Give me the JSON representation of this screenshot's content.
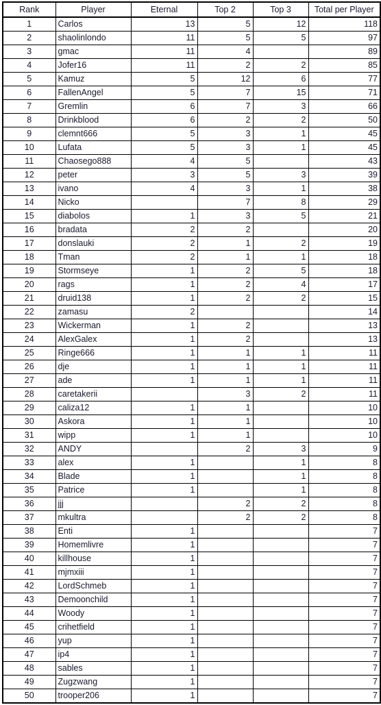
{
  "table": {
    "columns": [
      {
        "key": "rank",
        "label": "Rank",
        "align": "center"
      },
      {
        "key": "player",
        "label": "Player",
        "align": "left"
      },
      {
        "key": "eternal",
        "label": "Eternal",
        "align": "right"
      },
      {
        "key": "top2",
        "label": "Top 2",
        "align": "right"
      },
      {
        "key": "top3",
        "label": "Top 3",
        "align": "right"
      },
      {
        "key": "total",
        "label": "Total per Player",
        "align": "right"
      }
    ],
    "row_count": 50,
    "colors": {
      "text": "#1a1a2e",
      "grid": "#000000",
      "background": "#ffffff"
    },
    "rows": [
      {
        "rank": "1",
        "player": "Carlos",
        "eternal": "13",
        "top2": "5",
        "top3": "12",
        "total": "118"
      },
      {
        "rank": "2",
        "player": "shaolinlondo",
        "eternal": "11",
        "top2": "5",
        "top3": "5",
        "total": "97"
      },
      {
        "rank": "3",
        "player": "gmac",
        "eternal": "11",
        "top2": "4",
        "top3": "",
        "total": "89"
      },
      {
        "rank": "4",
        "player": "Jofer16",
        "eternal": "11",
        "top2": "2",
        "top3": "2",
        "total": "85"
      },
      {
        "rank": "5",
        "player": "Kamuz",
        "eternal": "5",
        "top2": "12",
        "top3": "6",
        "total": "77"
      },
      {
        "rank": "6",
        "player": "FallenAngel",
        "eternal": "5",
        "top2": "7",
        "top3": "15",
        "total": "71"
      },
      {
        "rank": "7",
        "player": "Gremlin",
        "eternal": "6",
        "top2": "7",
        "top3": "3",
        "total": "66"
      },
      {
        "rank": "8",
        "player": "Drinkblood",
        "eternal": "6",
        "top2": "2",
        "top3": "2",
        "total": "50"
      },
      {
        "rank": "9",
        "player": "clemnt666",
        "eternal": "5",
        "top2": "3",
        "top3": "1",
        "total": "45"
      },
      {
        "rank": "10",
        "player": "Lufata",
        "eternal": "5",
        "top2": "3",
        "top3": "1",
        "total": "45"
      },
      {
        "rank": "11",
        "player": "Chaosego888",
        "eternal": "4",
        "top2": "5",
        "top3": "",
        "total": "43"
      },
      {
        "rank": "12",
        "player": "peter",
        "eternal": "3",
        "top2": "5",
        "top3": "3",
        "total": "39"
      },
      {
        "rank": "13",
        "player": "ivano",
        "eternal": "4",
        "top2": "3",
        "top3": "1",
        "total": "38"
      },
      {
        "rank": "14",
        "player": "Nicko",
        "eternal": "",
        "top2": "7",
        "top3": "8",
        "total": "29"
      },
      {
        "rank": "15",
        "player": "diabolos",
        "eternal": "1",
        "top2": "3",
        "top3": "5",
        "total": "21"
      },
      {
        "rank": "16",
        "player": "bradata",
        "eternal": "2",
        "top2": "2",
        "top3": "",
        "total": "20"
      },
      {
        "rank": "17",
        "player": "donslauki",
        "eternal": "2",
        "top2": "1",
        "top3": "2",
        "total": "19"
      },
      {
        "rank": "18",
        "player": "Tman",
        "eternal": "2",
        "top2": "1",
        "top3": "1",
        "total": "18"
      },
      {
        "rank": "19",
        "player": "Stormseye",
        "eternal": "1",
        "top2": "2",
        "top3": "5",
        "total": "18"
      },
      {
        "rank": "20",
        "player": "rags",
        "eternal": "1",
        "top2": "2",
        "top3": "4",
        "total": "17"
      },
      {
        "rank": "21",
        "player": "druid138",
        "eternal": "1",
        "top2": "2",
        "top3": "2",
        "total": "15"
      },
      {
        "rank": "22",
        "player": "zamasu",
        "eternal": "2",
        "top2": "",
        "top3": "",
        "total": "14"
      },
      {
        "rank": "23",
        "player": "Wickerman",
        "eternal": "1",
        "top2": "2",
        "top3": "",
        "total": "13"
      },
      {
        "rank": "24",
        "player": "AlexGalex",
        "eternal": "1",
        "top2": "2",
        "top3": "",
        "total": "13"
      },
      {
        "rank": "25",
        "player": "Ringe666",
        "eternal": "1",
        "top2": "1",
        "top3": "1",
        "total": "11"
      },
      {
        "rank": "26",
        "player": "dje",
        "eternal": "1",
        "top2": "1",
        "top3": "1",
        "total": "11"
      },
      {
        "rank": "27",
        "player": "ade",
        "eternal": "1",
        "top2": "1",
        "top3": "1",
        "total": "11"
      },
      {
        "rank": "28",
        "player": "caretakerii",
        "eternal": "",
        "top2": "3",
        "top3": "2",
        "total": "11"
      },
      {
        "rank": "29",
        "player": "caliza12",
        "eternal": "1",
        "top2": "1",
        "top3": "",
        "total": "10"
      },
      {
        "rank": "30",
        "player": "Askora",
        "eternal": "1",
        "top2": "1",
        "top3": "",
        "total": "10"
      },
      {
        "rank": "31",
        "player": "wipp",
        "eternal": "1",
        "top2": "1",
        "top3": "",
        "total": "10"
      },
      {
        "rank": "32",
        "player": "ANDY",
        "eternal": "",
        "top2": "2",
        "top3": "3",
        "total": "9"
      },
      {
        "rank": "33",
        "player": "alex",
        "eternal": "1",
        "top2": "",
        "top3": "1",
        "total": "8"
      },
      {
        "rank": "34",
        "player": "Blade",
        "eternal": "1",
        "top2": "",
        "top3": "1",
        "total": "8"
      },
      {
        "rank": "35",
        "player": "Patrice",
        "eternal": "1",
        "top2": "",
        "top3": "1",
        "total": "8"
      },
      {
        "rank": "36",
        "player": "jjj",
        "eternal": "",
        "top2": "2",
        "top3": "2",
        "total": "8"
      },
      {
        "rank": "37",
        "player": "mkultra",
        "eternal": "",
        "top2": "2",
        "top3": "2",
        "total": "8"
      },
      {
        "rank": "38",
        "player": "Enti",
        "eternal": "1",
        "top2": "",
        "top3": "",
        "total": "7"
      },
      {
        "rank": "39",
        "player": "Homemlivre",
        "eternal": "1",
        "top2": "",
        "top3": "",
        "total": "7"
      },
      {
        "rank": "40",
        "player": "killhouse",
        "eternal": "1",
        "top2": "",
        "top3": "",
        "total": "7"
      },
      {
        "rank": "41",
        "player": "mjmxiii",
        "eternal": "1",
        "top2": "",
        "top3": "",
        "total": "7"
      },
      {
        "rank": "42",
        "player": "LordSchmeb",
        "eternal": "1",
        "top2": "",
        "top3": "",
        "total": "7"
      },
      {
        "rank": "43",
        "player": "Demoonchild",
        "eternal": "1",
        "top2": "",
        "top3": "",
        "total": "7"
      },
      {
        "rank": "44",
        "player": "Woody",
        "eternal": "1",
        "top2": "",
        "top3": "",
        "total": "7"
      },
      {
        "rank": "45",
        "player": "crihetfield",
        "eternal": "1",
        "top2": "",
        "top3": "",
        "total": "7"
      },
      {
        "rank": "46",
        "player": "yup",
        "eternal": "1",
        "top2": "",
        "top3": "",
        "total": "7"
      },
      {
        "rank": "47",
        "player": "ip4",
        "eternal": "1",
        "top2": "",
        "top3": "",
        "total": "7"
      },
      {
        "rank": "48",
        "player": "sables",
        "eternal": "1",
        "top2": "",
        "top3": "",
        "total": "7"
      },
      {
        "rank": "49",
        "player": "Zugzwang",
        "eternal": "1",
        "top2": "",
        "top3": "",
        "total": "7"
      },
      {
        "rank": "50",
        "player": "trooper206",
        "eternal": "1",
        "top2": "",
        "top3": "",
        "total": "7"
      }
    ]
  }
}
